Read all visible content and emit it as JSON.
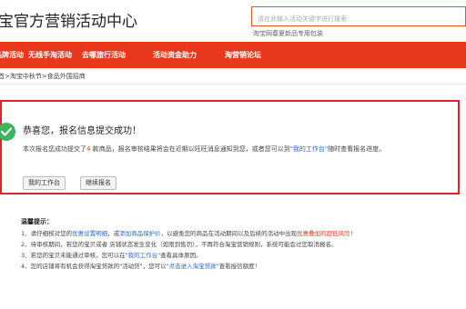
{
  "header": {
    "site_title": "宝官方营销活动中心",
    "search_placeholder": "请在此输入活动关键字进行搜索",
    "search_hint": "淘宝网春夏新品专用包装"
  },
  "nav": {
    "items": [
      {
        "label": "品牌活动"
      },
      {
        "label": "无线手淘活动"
      },
      {
        "label": "去哪旅行活动"
      },
      {
        "label": "活动资金助力"
      },
      {
        "label": "淘营销论坛"
      }
    ],
    "bar_color": "#e8381d"
  },
  "breadcrumb": "首>淘宝中秋节>食品外围招商",
  "success": {
    "title": "恭喜您，报名信息提交成功！",
    "text_1": "本次报名您成功提交了",
    "count": "4",
    "text_2": " 款商品，报名审核结果将会在近期以旺旺消息通知到您，或者您可以到",
    "workbench_link": "\"我的工作台\"",
    "text_3": "随时查看报名进度。",
    "btn_workbench": "我的工作台",
    "btn_continue": "继续报名",
    "accent_color": "#d9252c",
    "check_color": "#3cb55e"
  },
  "tips": {
    "title": "温馨提示：",
    "line1_a": "1、请仔细核对您的",
    "line1_link1": "优惠设置明细",
    "line1_b": "，或",
    "line1_link2": "添加商品保护价",
    "line1_c": "，以避免您的商品在活动期间以及后续的活动中出现",
    "line1_red": "优惠叠加的超低风险",
    "line1_d": "！",
    "line2": "2、待审核期间，若您的宝贝或者 店铺状态发生变化（如限到售罚），不再符合淘宝营销规则，系统可能会过您取消报名。",
    "line3_a": "3、若您的宝贝未能通过审核，您可以在",
    "line3_link": "\"我的工作台\"",
    "line3_b": "查看具体原因。",
    "line4_a": "4、您的店铺将有机会获得淘宝贷款的\"活动贷\"，您可以",
    "line4_link": "\"点击进入淘宝贷款\"",
    "line4_b": "查看授信额度！"
  }
}
